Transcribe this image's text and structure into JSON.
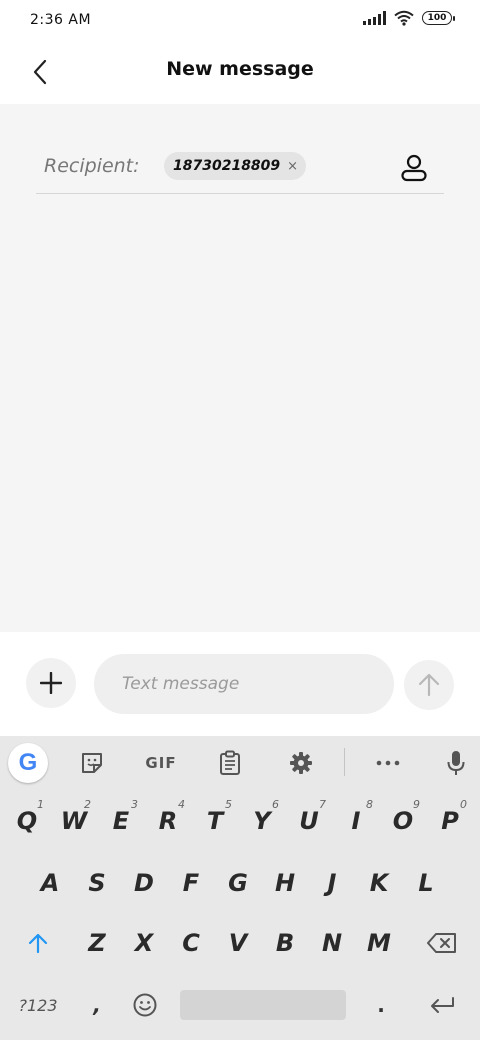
{
  "status_bar": {
    "time": "2:36 AM",
    "battery": "100",
    "icons": [
      "signal-icon",
      "wifi-icon",
      "battery-icon"
    ]
  },
  "header": {
    "title": "New message",
    "back_icon": "chevron-left-icon"
  },
  "recipient": {
    "label": "Recipient:",
    "chip_text": "18730218809",
    "chip_close": "×",
    "contact_icon": "contact-person-icon"
  },
  "compose": {
    "placeholder": "Text message",
    "add_icon": "plus-icon",
    "send_icon": "arrow-up-icon"
  },
  "keyboard": {
    "toolbar": {
      "google": "G",
      "gif": "GIF",
      "icons": [
        "sticker-icon",
        "clipboard-icon",
        "settings-gear-icon",
        "more-dots-icon",
        "mic-icon"
      ]
    },
    "row1": [
      {
        "key": "Q",
        "hint": "1"
      },
      {
        "key": "W",
        "hint": "2"
      },
      {
        "key": "E",
        "hint": "3"
      },
      {
        "key": "R",
        "hint": "4"
      },
      {
        "key": "T",
        "hint": "5"
      },
      {
        "key": "Y",
        "hint": "6"
      },
      {
        "key": "U",
        "hint": "7"
      },
      {
        "key": "I",
        "hint": "8"
      },
      {
        "key": "O",
        "hint": "9"
      },
      {
        "key": "P",
        "hint": "0"
      }
    ],
    "row2": [
      "A",
      "S",
      "D",
      "F",
      "G",
      "H",
      "J",
      "K",
      "L"
    ],
    "row3": [
      "Z",
      "X",
      "C",
      "V",
      "B",
      "N",
      "M"
    ],
    "bottom": {
      "symbols": "?123",
      "comma": ",",
      "period": ".",
      "icons": [
        "emoji-icon",
        "enter-icon",
        "shift-icon",
        "backspace-icon"
      ]
    }
  },
  "colors": {
    "accent_blue": "#2196F3",
    "body_bg": "#f5f5f5",
    "keyboard_bg": "#e8e8e8"
  }
}
